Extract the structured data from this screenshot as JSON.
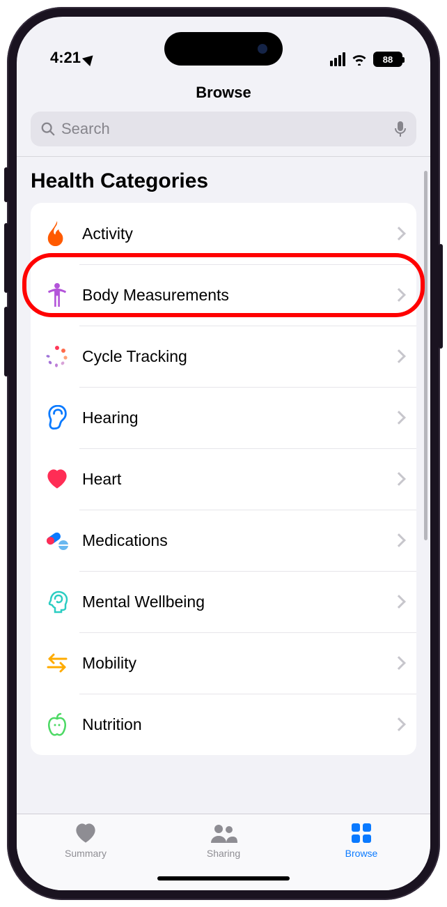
{
  "status": {
    "time": "4:21",
    "battery": "88"
  },
  "nav": {
    "title": "Browse"
  },
  "search": {
    "placeholder": "Search"
  },
  "section": {
    "title": "Health Categories",
    "items": [
      {
        "label": "Activity"
      },
      {
        "label": "Body Measurements"
      },
      {
        "label": "Cycle Tracking"
      },
      {
        "label": "Hearing"
      },
      {
        "label": "Heart"
      },
      {
        "label": "Medications"
      },
      {
        "label": "Mental Wellbeing"
      },
      {
        "label": "Mobility"
      },
      {
        "label": "Nutrition"
      }
    ]
  },
  "tabs": {
    "summary": "Summary",
    "sharing": "Sharing",
    "browse": "Browse"
  },
  "highlighted_item_index": 1
}
